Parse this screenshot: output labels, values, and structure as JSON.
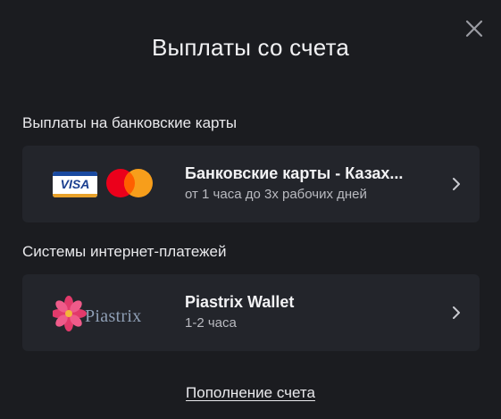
{
  "modal": {
    "title": "Выплаты со счета",
    "close_icon": "close-icon"
  },
  "sections": [
    {
      "label": "Выплаты на банковские карты",
      "method": {
        "title": "Банковские карты - Казах...",
        "subtitle": "от 1 часа до 3х рабочих дней",
        "logos": [
          "visa-logo",
          "mastercard-logo"
        ],
        "logo_text": "VISA"
      }
    },
    {
      "label": "Системы интернет-платежей",
      "method": {
        "title": "Piastrix Wallet",
        "subtitle": "1-2 часа",
        "logos": [
          "piastrix-logo"
        ],
        "logo_text": "Piastrix"
      }
    }
  ],
  "footer": {
    "link_label": "Пополнение счета"
  },
  "colors": {
    "background": "#1b1c20",
    "card": "#23252b",
    "text": "#f2f2f4",
    "muted_text": "#b9bac0"
  }
}
